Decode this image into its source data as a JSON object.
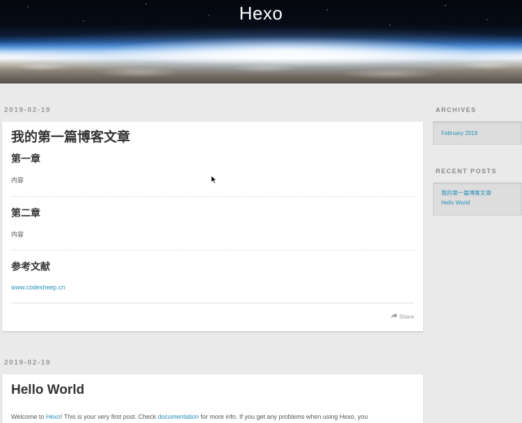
{
  "site": {
    "title": "Hexo"
  },
  "posts": [
    {
      "date": "2019-02-19",
      "title": "我的第一篇博客文章",
      "sections": [
        {
          "heading": "第一章",
          "text": "内容"
        },
        {
          "heading": "第二章",
          "text": "内容"
        },
        {
          "heading": "参考文献",
          "link": "www.codesheep.cn"
        }
      ],
      "share_label": "Share"
    },
    {
      "date": "2019-02-19",
      "title": "Hello World",
      "excerpt": {
        "prefix": "Welcome to ",
        "link1": "Hexo",
        "middle": "! This is your very first post. Check ",
        "link2": "documentation",
        "suffix": " for more info. If you get any problems when using Hexo, you"
      }
    }
  ],
  "sidebar": {
    "archives": {
      "title": "ARCHIVES",
      "items": [
        "February 2019"
      ]
    },
    "recent_posts": {
      "title": "RECENT POSTS",
      "items": [
        "我的第一篇博客文章",
        "Hello World"
      ]
    }
  },
  "icons": {
    "share": "share-arrow-icon",
    "cursor": "mouse-pointer-icon"
  },
  "colors": {
    "link": "#258fb8",
    "background": "#eaeaea",
    "card": "#ffffff"
  }
}
